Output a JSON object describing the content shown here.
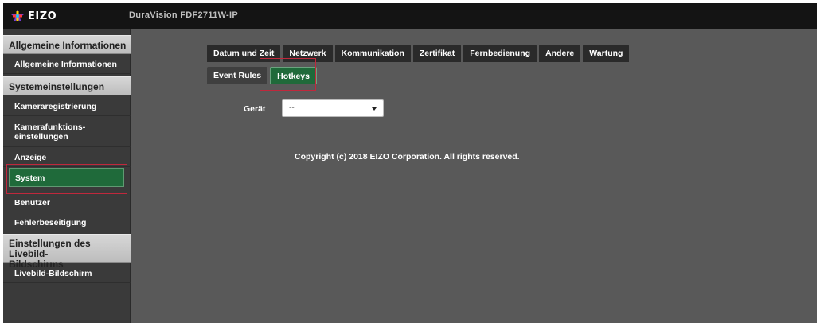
{
  "app": {
    "logo_text": "EIZO",
    "device_name": "DuraVision FDF2711W-IP"
  },
  "sidebar": {
    "sections": [
      {
        "title": "Allgemeine Informationen",
        "items": [
          "Allgemeine Informationen"
        ]
      },
      {
        "title": "Systemeinstellungen",
        "items": [
          "Kameraregistrierung",
          "Kamerafunktions-\neinstellungen",
          "Anzeige",
          "System",
          "Benutzer",
          "Fehlerbeseitigung"
        ]
      },
      {
        "title": "Einstellungen des Livebild-\nBildschirms",
        "items": [
          "Livebild-Bildschirm"
        ]
      }
    ],
    "active_item": "System"
  },
  "tabs": {
    "row1": [
      "Datum und Zeit",
      "Netzwerk",
      "Kommunikation",
      "Zertifikat",
      "Fernbedienung",
      "Andere",
      "Wartung"
    ],
    "row2": [
      "Event Rules",
      "Hotkeys"
    ],
    "active": "Hotkeys"
  },
  "form": {
    "device_label": "Gerät",
    "device_value": "--"
  },
  "footer": {
    "copyright": "Copyright (c) 2018 EIZO Corporation. All rights reserved."
  },
  "colors": {
    "accent_green": "#1f6a3a",
    "highlight_red": "#c0283c"
  }
}
